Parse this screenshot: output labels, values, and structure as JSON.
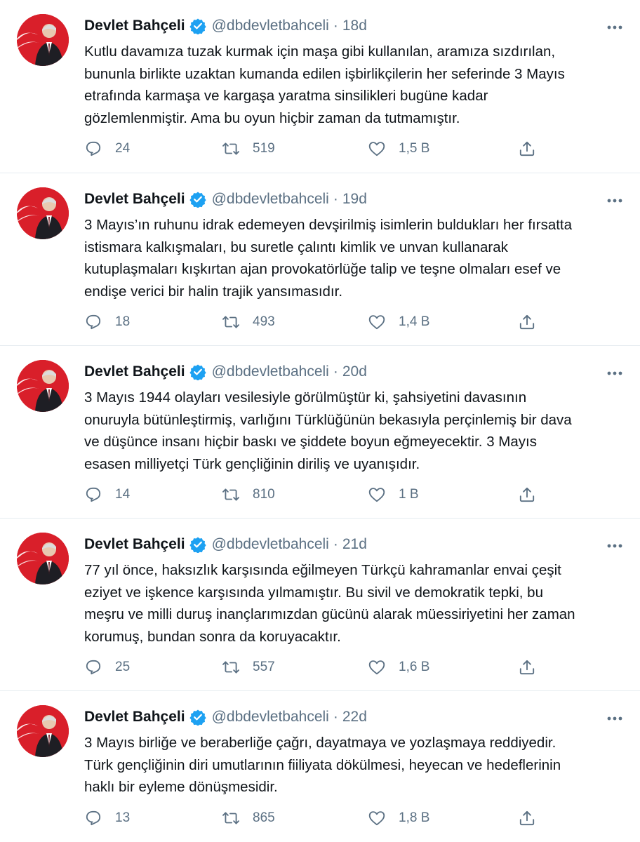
{
  "colors": {
    "accent": "#1da1f2",
    "muted": "#5b7083",
    "text": "#0f1419",
    "divider": "#e6ecf0",
    "avatar_red": "#d91f2a"
  },
  "icons": {
    "reply": "reply-icon",
    "retweet": "retweet-icon",
    "like": "heart-icon",
    "share": "share-icon",
    "verified": "verified-badge-icon",
    "more": "more-options-icon"
  },
  "tweets": [
    {
      "name": "Devlet Bahçeli",
      "handle": "@dbdevletbahceli",
      "time": "18d",
      "lines": [
        "Kutlu davamıza tuzak kurmak için maşa gibi kullanılan, aramıza sızdırılan,",
        "bununla birlikte uzaktan kumanda edilen işbirlikçilerin her seferinde 3 Mayıs",
        "etrafında karmaşa ve kargaşa yaratma sinsilikleri bugüne kadar",
        "gözlemlenmiştir. Ama bu oyun hiçbir zaman da tutmamıştır."
      ],
      "replies": "24",
      "retweets": "519",
      "likes": "1,5 B"
    },
    {
      "name": "Devlet Bahçeli",
      "handle": "@dbdevletbahceli",
      "time": "19d",
      "lines": [
        "3 Mayıs’ın ruhunu idrak edemeyen devşirilmiş isimlerin buldukları her fırsatta",
        "istismara kalkışmaları, bu suretle çalıntı kimlik ve unvan kullanarak",
        "kutuplaşmaları kışkırtan ajan provokatörlüğe talip ve teşne olmaları esef ve",
        "endişe verici bir halin trajik yansımasıdır."
      ],
      "replies": "18",
      "retweets": "493",
      "likes": "1,4 B"
    },
    {
      "name": "Devlet Bahçeli",
      "handle": "@dbdevletbahceli",
      "time": "20d",
      "lines": [
        "3 Mayıs 1944 olayları vesilesiyle görülmüştür ki, şahsiyetini davasının",
        "onuruyla bütünleştirmiş, varlığını Türklüğünün bekasıyla perçinlemiş bir dava",
        "ve düşünce insanı hiçbir baskı ve şiddete boyun eğmeyecektir. 3 Mayıs",
        "esasen milliyetçi Türk gençliğinin diriliş ve uyanışıdır."
      ],
      "replies": "14",
      "retweets": "810",
      "likes": "1 B"
    },
    {
      "name": "Devlet Bahçeli",
      "handle": "@dbdevletbahceli",
      "time": "21d",
      "lines": [
        "77 yıl önce, haksızlık karşısında eğilmeyen Türkçü kahramanlar envai çeşit",
        "eziyet ve işkence karşısında yılmamıştır. Bu sivil ve demokratik tepki, bu",
        "meşru ve milli duruş inançlarımızdan gücünü alarak müessiriyetini her zaman",
        "korumuş, bundan sonra da koruyacaktır."
      ],
      "replies": "25",
      "retweets": "557",
      "likes": "1,6 B"
    },
    {
      "name": "Devlet Bahçeli",
      "handle": "@dbdevletbahceli",
      "time": "22d",
      "lines": [
        "3 Mayıs birliğe ve beraberliğe çağrı, dayatmaya ve yozlaşmaya reddiyedir.",
        "Türk gençliğinin diri umutlarının fiiliyata dökülmesi, heyecan ve hedeflerinin",
        "haklı bir eyleme dönüşmesidir."
      ],
      "replies": "13",
      "retweets": "865",
      "likes": "1,8 B"
    }
  ]
}
